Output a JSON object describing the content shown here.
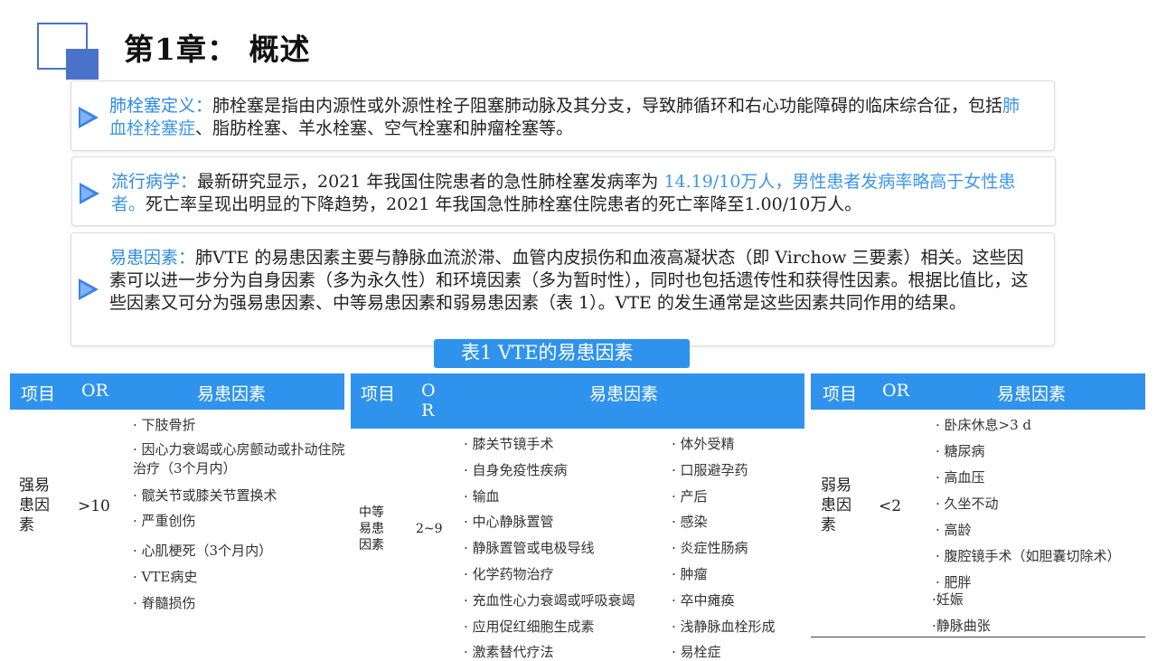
{
  "header": {
    "title": "第1章： 概述"
  },
  "cards": {
    "definition": {
      "label": "肺栓塞定义：",
      "text1": "肺栓塞是指由内源性或外源性栓子阻塞肺动脉及其分支，导致肺循环和右心功能障碍的临床综合征，包括",
      "highlight": "肺血栓栓塞症",
      "text2": "、脂肪栓塞、羊水栓塞、空气栓塞和肿瘤栓塞等。"
    },
    "epidemiology": {
      "label": "流行病学：",
      "text1": "最新研究显示，2021 年我国住院患者的急性肺栓塞发病率为 ",
      "highlight": "14.19/10万人，男性患者发病率略高于女性患者。",
      "text2": "死亡率呈现出明显的下降趋势，2021 年我国急性肺栓塞住院患者的死亡率降至1.00/10万人。"
    },
    "risk": {
      "label": "易患因素：",
      "text": "肺VTE 的易患因素主要与静脉血流淤滞、血管内皮损伤和血液高凝状态（即 Virchow 三要素）相关。这些因素可以进一步分为自身因素（多为永久性）和环境因素（多为暂时性），同时也包括遗传性和获得性因素。根据比值比，这些因素又可分为强易患因素、中等易患因素和弱易患因素（表 1）。VTE 的发生通常是这些因素共同作用的结果。"
    }
  },
  "table": {
    "caption": "表1  VTE的易患因素",
    "headers": {
      "item": "项目",
      "or": "OR",
      "or_v": "O R",
      "factors": "易患因素"
    },
    "strong": {
      "category": "强易患因素",
      "or": ">10",
      "factors": [
        "· 下肢骨折",
        "· 因心力衰竭或心房颤动或扑动住院治疗（3个月内）",
        "· 髋关节或膝关节置换术",
        "· 严重创伤",
        "· 心肌梗死（3个月内）",
        "·  VTE病史",
        "· 脊髓损伤"
      ]
    },
    "moderate": {
      "category": "中等易患因素",
      "or": "2~9",
      "factors_left": [
        "· 膝关节镜手术",
        "· 自身免疫性疾病",
        "· 输血",
        "· 中心静脉置管",
        "· 静脉置管或电极导线",
        "· 化学药物治疗",
        "· 充血性心力衰竭或呼吸衰竭",
        "· 应用促红细胞生成素",
        "· 激素替代疗法"
      ],
      "factors_right": [
        "· 体外受精",
        "· 口服避孕药",
        "· 产后",
        "· 感染",
        "· 炎症性肠病",
        "· 肿瘤",
        "· 卒中瘫痪",
        "· 浅静脉血栓形成",
        "· 易栓症"
      ]
    },
    "weak": {
      "category": "弱易患因素",
      "or": "<2",
      "factors": [
        "· 卧床休息>3 d",
        "· 糖尿病",
        "· 高血压",
        "· 久坐不动",
        "· 高龄",
        "·  腹腔镜手术（如胆囊切除术）",
        "· 肥胖",
        "·妊娠",
        "·静脉曲张"
      ]
    }
  }
}
